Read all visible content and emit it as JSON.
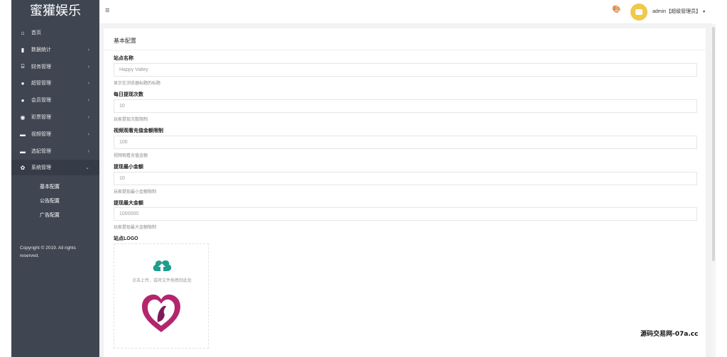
{
  "brand": {
    "title": "蜜獾娱乐"
  },
  "sidebar": {
    "items": [
      {
        "label": "首页",
        "icon": "home-icon",
        "glyph": "⌂",
        "has_arrow": false
      },
      {
        "label": "数据统计",
        "icon": "bar-chart-icon",
        "glyph": "▮",
        "has_arrow": true
      },
      {
        "label": "财务管理",
        "icon": "bank-icon",
        "glyph": "⌸",
        "has_arrow": true
      },
      {
        "label": "超管管理",
        "icon": "user-icon",
        "glyph": "●",
        "has_arrow": true
      },
      {
        "label": "会员管理",
        "icon": "users-icon",
        "glyph": "●",
        "has_arrow": true
      },
      {
        "label": "彩票管理",
        "icon": "gamepad-icon",
        "glyph": "◉",
        "has_arrow": true
      },
      {
        "label": "视频管理",
        "icon": "video-icon",
        "glyph": "▬",
        "has_arrow": true
      },
      {
        "label": "选妃管理",
        "icon": "video-icon",
        "glyph": "▬",
        "has_arrow": true
      },
      {
        "label": "系统管理",
        "icon": "gear-icon",
        "glyph": "✿",
        "has_arrow": true,
        "expanded": true
      }
    ],
    "subitems": [
      {
        "label": "基本配置"
      },
      {
        "label": "公告配置"
      },
      {
        "label": "广告配置"
      }
    ],
    "arrow": "›",
    "arrow_open": "⌄",
    "copyright": "Copyright © 2019. All rights reserved."
  },
  "topbar": {
    "menu_toggle_icon": "≡",
    "palette_icon": "🎨",
    "user_label": "admin【超级管理员】",
    "caret": "▾"
  },
  "page": {
    "title": "基本配置",
    "fields": [
      {
        "label": "站点名称",
        "value": "Happy Valley",
        "help": "显示在浏览器标题的标题"
      },
      {
        "label": "每日提现次数",
        "value": "10",
        "help": "玩家提现次数限制"
      },
      {
        "label": "视频观看充值金额限制",
        "value": "100",
        "help": "视频观看充值金额"
      },
      {
        "label": "提现最小金额",
        "value": "10",
        "help": "玩家提现最小金额限制"
      },
      {
        "label": "提现最大金额",
        "value": "1000000",
        "help": "玩家提现最大金额限制"
      }
    ],
    "logo_label": "站点LOGO",
    "upload_text": "点击上传，或将文件拖拽到此处"
  },
  "watermark": "源码交易网-07a.cc",
  "colors": {
    "sidebar_bg": "#3f4652",
    "upload_icon": "#1e9e8f",
    "logo_heart_outer": "#b3266e",
    "logo_heart_inner": "#7d1b5b"
  }
}
